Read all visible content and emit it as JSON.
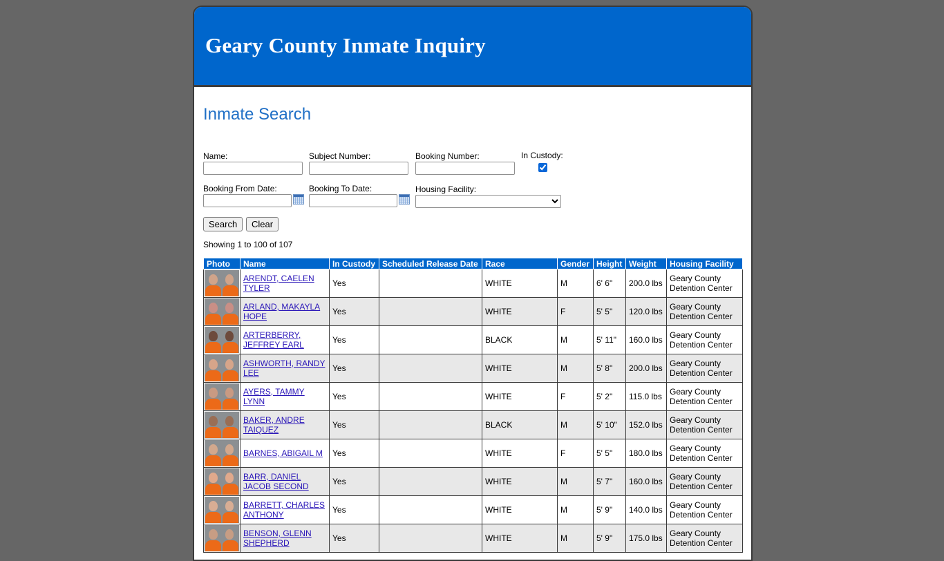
{
  "header": {
    "title": "Geary County Inmate Inquiry"
  },
  "page_title": "Inmate Search",
  "form": {
    "name_label": "Name:",
    "name_value": "",
    "subject_label": "Subject Number:",
    "subject_value": "",
    "booking_label": "Booking Number:",
    "booking_value": "",
    "custody_label": "In Custody:",
    "custody_checked": true,
    "from_label": "Booking From Date:",
    "from_value": "",
    "to_label": "Booking To Date:",
    "to_value": "",
    "facility_label": "Housing Facility:",
    "facility_selected": "",
    "search_label": "Search",
    "clear_label": "Clear"
  },
  "results": {
    "showing": "Showing 1 to 100 of 107",
    "columns": [
      "Photo",
      "Name",
      "In Custody",
      "Scheduled Release Date",
      "Race",
      "Gender",
      "Height",
      "Weight",
      "Housing Facility"
    ],
    "rows": [
      {
        "name": "ARENDT, CAELEN TYLER",
        "custody": "Yes",
        "release": "",
        "race": "WHITE",
        "gender": "M",
        "height": "6' 6\"",
        "weight": "200.0 lbs",
        "facility": "Geary County Detention Center"
      },
      {
        "name": "ARLAND, MAKAYLA HOPE",
        "custody": "Yes",
        "release": "",
        "race": "WHITE",
        "gender": "F",
        "height": "5' 5\"",
        "weight": "120.0 lbs",
        "facility": "Geary County Detention Center"
      },
      {
        "name": "ARTERBERRY, JEFFREY EARL",
        "custody": "Yes",
        "release": "",
        "race": "BLACK",
        "gender": "M",
        "height": "5' 11\"",
        "weight": "160.0 lbs",
        "facility": "Geary County Detention Center"
      },
      {
        "name": "ASHWORTH, RANDY LEE",
        "custody": "Yes",
        "release": "",
        "race": "WHITE",
        "gender": "M",
        "height": "5' 8\"",
        "weight": "200.0 lbs",
        "facility": "Geary County Detention Center"
      },
      {
        "name": "AYERS, TAMMY LYNN",
        "custody": "Yes",
        "release": "",
        "race": "WHITE",
        "gender": "F",
        "height": "5' 2\"",
        "weight": "115.0 lbs",
        "facility": "Geary County Detention Center"
      },
      {
        "name": "BAKER, ANDRE TAIQUEZ",
        "custody": "Yes",
        "release": "",
        "race": "BLACK",
        "gender": "M",
        "height": "5' 10\"",
        "weight": "152.0 lbs",
        "facility": "Geary County Detention Center"
      },
      {
        "name": "BARNES, ABIGAIL M",
        "custody": "Yes",
        "release": "",
        "race": "WHITE",
        "gender": "F",
        "height": "5' 5\"",
        "weight": "180.0 lbs",
        "facility": "Geary County Detention Center"
      },
      {
        "name": "BARR, DANIEL JACOB SECOND",
        "custody": "Yes",
        "release": "",
        "race": "WHITE",
        "gender": "M",
        "height": "5' 7\"",
        "weight": "160.0 lbs",
        "facility": "Geary County Detention Center"
      },
      {
        "name": "BARRETT, CHARLES ANTHONY",
        "custody": "Yes",
        "release": "",
        "race": "WHITE",
        "gender": "M",
        "height": "5' 9\"",
        "weight": "140.0 lbs",
        "facility": "Geary County Detention Center"
      },
      {
        "name": "BENSON, GLENN SHEPHERD",
        "custody": "Yes",
        "release": "",
        "race": "WHITE",
        "gender": "M",
        "height": "5' 9\"",
        "weight": "175.0 lbs",
        "facility": "Geary County Detention Center"
      }
    ]
  },
  "colors": {
    "banner": "#0066cc",
    "background": "#666666",
    "title": "#1f6fc6",
    "table_header": "#0066cc"
  },
  "icons": {
    "calendar": "calendar-icon",
    "select": "chevron-down-icon"
  }
}
